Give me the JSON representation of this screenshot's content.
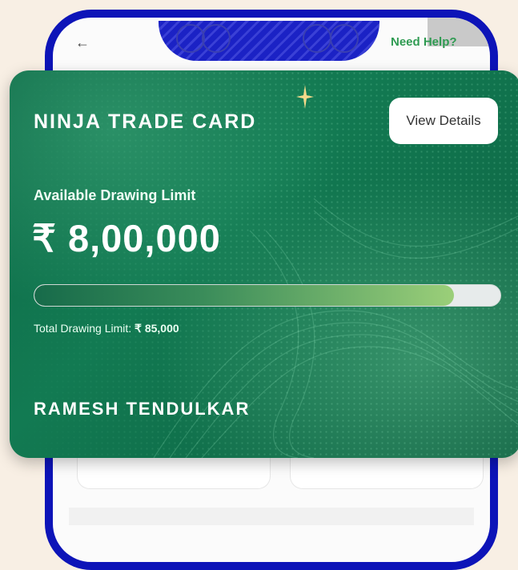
{
  "header": {
    "need_help": "Need Help?"
  },
  "card": {
    "title": "NINJA TRADE CARD",
    "view_details_label": "View Details",
    "available_label": "Available Drawing Limit",
    "available_amount": "₹ 8,00,000",
    "progress_fraction": 0.9,
    "total_limit_label": "Total Drawing Limit: ",
    "total_limit_value": "₹ 85,000",
    "holder_name": "RAMESH TENDULKAR"
  },
  "icons": {
    "back": "back-arrow-icon",
    "sparkle": "sparkle-icon"
  },
  "colors": {
    "phone_frame": "#0d14b8",
    "card_green": "#127a52",
    "help_green": "#2f9b52"
  }
}
